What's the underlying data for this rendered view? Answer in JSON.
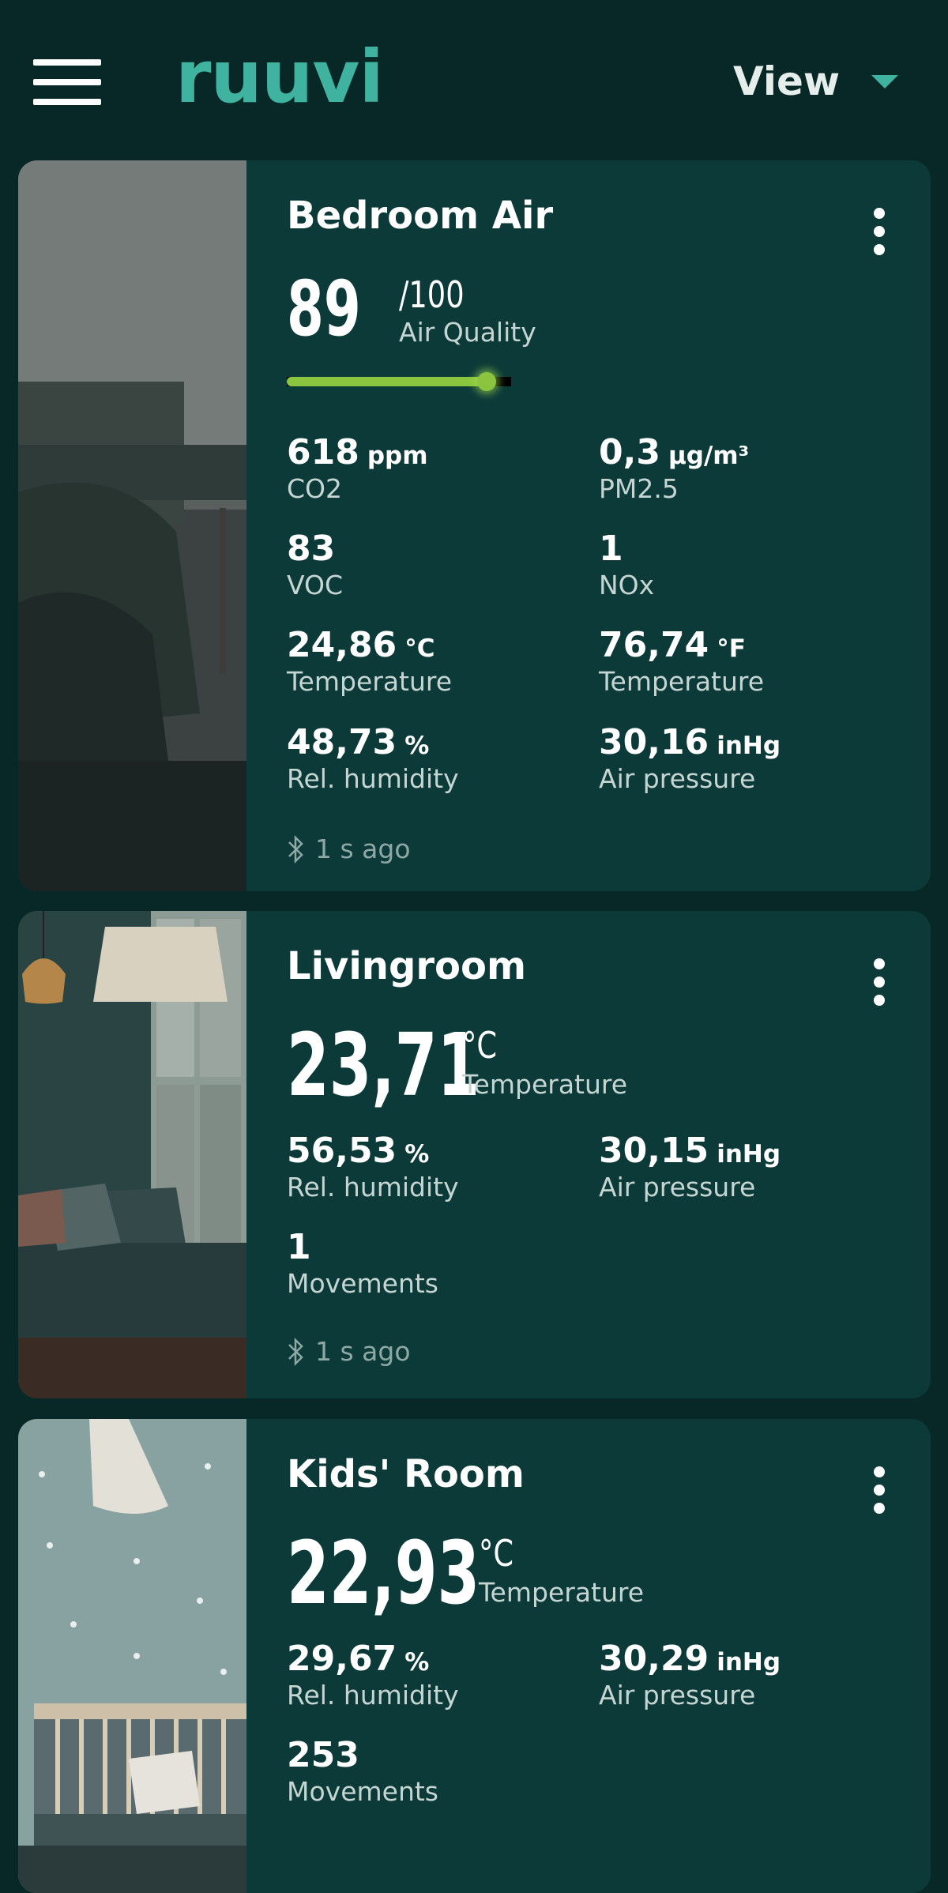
{
  "header": {
    "logo_text": "ruuvi",
    "view_label": "View",
    "accent_color": "#3fb39f"
  },
  "cards": [
    {
      "title": "Bedroom Air",
      "big_value": "89",
      "big_unit": "/100",
      "big_label": "Air Quality",
      "air_quality_fraction": 0.89,
      "metrics": [
        {
          "value": "618",
          "unit": "ppm",
          "label": "CO2"
        },
        {
          "value": "0,3",
          "unit": "µg/m³",
          "label": "PM2.5"
        },
        {
          "value": "83",
          "unit": "",
          "label": "VOC"
        },
        {
          "value": "1",
          "unit": "",
          "label": "NOx"
        },
        {
          "value": "24,86",
          "unit": "°C",
          "label": "Temperature"
        },
        {
          "value": "76,74",
          "unit": "°F",
          "label": "Temperature"
        },
        {
          "value": "48,73",
          "unit": "%",
          "label": "Rel. humidity"
        },
        {
          "value": "30,16",
          "unit": "inHg",
          "label": "Air pressure"
        }
      ],
      "updated": "1 s ago"
    },
    {
      "title": "Livingroom",
      "big_value": "23,71",
      "big_unit": "°C",
      "big_label": "Temperature",
      "metrics": [
        {
          "value": "56,53",
          "unit": "%",
          "label": "Rel. humidity"
        },
        {
          "value": "30,15",
          "unit": "inHg",
          "label": "Air pressure"
        },
        {
          "value": "1",
          "unit": "",
          "label": "Movements"
        }
      ],
      "updated": "1 s ago"
    },
    {
      "title": "Kids' Room",
      "big_value": "22,93",
      "big_unit": "°C",
      "big_label": "Temperature",
      "metrics": [
        {
          "value": "29,67",
          "unit": "%",
          "label": "Rel. humidity"
        },
        {
          "value": "30,29",
          "unit": "inHg",
          "label": "Air pressure"
        },
        {
          "value": "253",
          "unit": "",
          "label": "Movements"
        }
      ]
    }
  ]
}
